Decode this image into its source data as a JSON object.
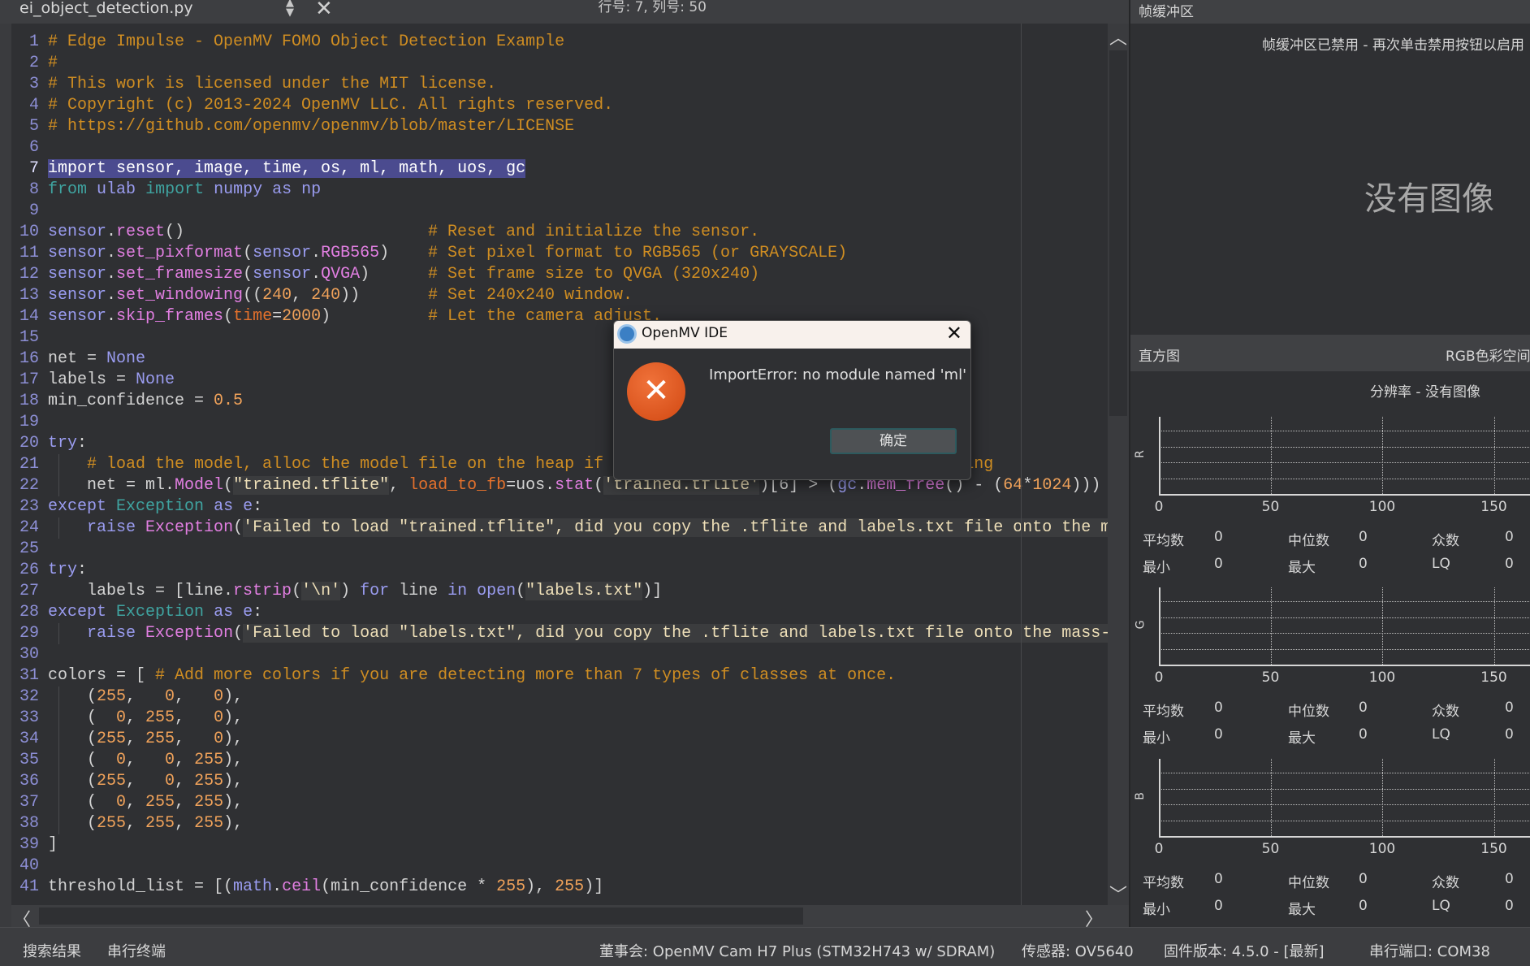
{
  "editor": {
    "filename": "ei_object_detection.py",
    "cursor_position": "行号: 7, 列号: 50",
    "current_line": 7,
    "lines": [
      {
        "n": 1,
        "tokens": [
          [
            "# Edge Impulse - OpenMV FOMO Object Detection Example",
            "c"
          ]
        ]
      },
      {
        "n": 2,
        "tokens": [
          [
            "#",
            "c"
          ]
        ]
      },
      {
        "n": 3,
        "tokens": [
          [
            "# This work is licensed under the MIT license.",
            "c"
          ]
        ]
      },
      {
        "n": 4,
        "tokens": [
          [
            "# Copyright (c) 2013-2024 OpenMV LLC. All rights reserved.",
            "c"
          ]
        ]
      },
      {
        "n": 5,
        "tokens": [
          [
            "# https://github.com/openmv/openmv/blob/master/LICENSE",
            "c"
          ]
        ]
      },
      {
        "n": 6,
        "tokens": []
      },
      {
        "n": 7,
        "tokens": [
          [
            "import sensor, image, time, os, ml, math, uos, gc",
            "sel"
          ]
        ]
      },
      {
        "n": 8,
        "tokens": [
          [
            "from",
            "k"
          ],
          [
            " ",
            "t"
          ],
          [
            "ulab",
            "v"
          ],
          [
            " ",
            "t"
          ],
          [
            "import",
            "k"
          ],
          [
            " ",
            "t"
          ],
          [
            "numpy as np",
            "v"
          ]
        ]
      },
      {
        "n": 9,
        "tokens": []
      },
      {
        "n": 10,
        "tokens": [
          [
            "sensor",
            "v"
          ],
          [
            ".",
            "t"
          ],
          [
            "reset",
            "f"
          ],
          [
            "()",
            "t"
          ],
          [
            "# Reset and initialize the sensor.",
            "ac"
          ]
        ]
      },
      {
        "n": 11,
        "tokens": [
          [
            "sensor",
            "v"
          ],
          [
            ".",
            "t"
          ],
          [
            "set_pixformat",
            "f"
          ],
          [
            "(",
            "t"
          ],
          [
            "sensor",
            "v"
          ],
          [
            ".",
            "t"
          ],
          [
            "RGB565",
            "f"
          ],
          [
            ")",
            "t"
          ],
          [
            "# Set pixel format to RGB565 (or GRAYSCALE)",
            "ac"
          ]
        ]
      },
      {
        "n": 12,
        "tokens": [
          [
            "sensor",
            "v"
          ],
          [
            ".",
            "t"
          ],
          [
            "set_framesize",
            "f"
          ],
          [
            "(",
            "t"
          ],
          [
            "sensor",
            "v"
          ],
          [
            ".",
            "t"
          ],
          [
            "QVGA",
            "f"
          ],
          [
            ")",
            "t"
          ],
          [
            "# Set frame size to QVGA (320x240)",
            "ac"
          ]
        ]
      },
      {
        "n": 13,
        "tokens": [
          [
            "sensor",
            "v"
          ],
          [
            ".",
            "t"
          ],
          [
            "set_windowing",
            "f"
          ],
          [
            "((",
            "t"
          ],
          [
            "240",
            "n"
          ],
          [
            ", ",
            "t"
          ],
          [
            "240",
            "n"
          ],
          [
            "))",
            "t"
          ],
          [
            "# Set 240x240 window.",
            "ac"
          ]
        ]
      },
      {
        "n": 14,
        "tokens": [
          [
            "sensor",
            "v"
          ],
          [
            ".",
            "t"
          ],
          [
            "skip_frames",
            "f"
          ],
          [
            "(",
            "t"
          ],
          [
            "time",
            "o"
          ],
          [
            "=",
            "t"
          ],
          [
            "2000",
            "n"
          ],
          [
            ")",
            "t"
          ],
          [
            "# Let the camera adjust.",
            "ac"
          ]
        ]
      },
      {
        "n": 15,
        "tokens": []
      },
      {
        "n": 16,
        "tokens": [
          [
            "net = ",
            "t"
          ],
          [
            "None",
            "v"
          ]
        ]
      },
      {
        "n": 17,
        "tokens": [
          [
            "labels = ",
            "t"
          ],
          [
            "None",
            "v"
          ]
        ]
      },
      {
        "n": 18,
        "tokens": [
          [
            "min_confidence = ",
            "t"
          ],
          [
            "0.5",
            "n"
          ]
        ]
      },
      {
        "n": 19,
        "tokens": []
      },
      {
        "n": 20,
        "tokens": [
          [
            "try",
            "v"
          ],
          [
            ":",
            "t"
          ]
        ]
      },
      {
        "n": 21,
        "tokens": [
          [
            "    ",
            "t"
          ],
          [
            "# load the model, alloc the model file on the heap if we have at least 64K free after loading",
            "c"
          ]
        ]
      },
      {
        "n": 22,
        "tokens": [
          [
            "    net = ml.",
            "t"
          ],
          [
            "Model",
            "f"
          ],
          [
            "(",
            "t"
          ],
          [
            "\"trained.tflite\"",
            "s"
          ],
          [
            ", ",
            "t"
          ],
          [
            "load_to_fb",
            "o"
          ],
          [
            "=uos.",
            "t"
          ],
          [
            "stat",
            "f"
          ],
          [
            "(",
            "t"
          ],
          [
            "'trained.tflite'",
            "s"
          ],
          [
            ")[6] > (",
            "t"
          ],
          [
            "gc",
            "v"
          ],
          [
            ".",
            "t"
          ],
          [
            "mem_free",
            "f"
          ],
          [
            "() - (",
            "t"
          ],
          [
            "64",
            "n"
          ],
          [
            "*",
            "t"
          ],
          [
            "1024",
            "n"
          ],
          [
            ")))",
            "t"
          ]
        ]
      },
      {
        "n": 23,
        "tokens": [
          [
            "except",
            "v"
          ],
          [
            " ",
            "t"
          ],
          [
            "Exception",
            "k"
          ],
          [
            " ",
            "t"
          ],
          [
            "as e",
            "v"
          ],
          [
            ":",
            "t"
          ]
        ]
      },
      {
        "n": 24,
        "tokens": [
          [
            "    ",
            "t"
          ],
          [
            "raise",
            "v"
          ],
          [
            " ",
            "t"
          ],
          [
            "Exception",
            "f"
          ],
          [
            "(",
            "t"
          ],
          [
            "'Failed to load \"trained.tflite\", did you copy the .tflite and labels.txt file onto the m",
            "s"
          ]
        ]
      },
      {
        "n": 25,
        "tokens": []
      },
      {
        "n": 26,
        "tokens": [
          [
            "try",
            "v"
          ],
          [
            ":",
            "t"
          ]
        ]
      },
      {
        "n": 27,
        "tokens": [
          [
            "    labels = [line.",
            "t"
          ],
          [
            "rstrip",
            "f"
          ],
          [
            "(",
            "t"
          ],
          [
            "'\\n'",
            "s"
          ],
          [
            ") ",
            "t"
          ],
          [
            "for",
            "v"
          ],
          [
            " line ",
            "t"
          ],
          [
            "in open",
            "v"
          ],
          [
            "(",
            "t"
          ],
          [
            "\"labels.txt\"",
            "s"
          ],
          [
            ")]",
            "t"
          ]
        ]
      },
      {
        "n": 28,
        "tokens": [
          [
            "except",
            "v"
          ],
          [
            " ",
            "t"
          ],
          [
            "Exception",
            "k"
          ],
          [
            " ",
            "t"
          ],
          [
            "as e",
            "v"
          ],
          [
            ":",
            "t"
          ]
        ]
      },
      {
        "n": 29,
        "tokens": [
          [
            "    ",
            "t"
          ],
          [
            "raise",
            "v"
          ],
          [
            " ",
            "t"
          ],
          [
            "Exception",
            "f"
          ],
          [
            "(",
            "t"
          ],
          [
            "'Failed to load \"labels.txt\", did you copy the .tflite and labels.txt file onto the mass-",
            "s"
          ]
        ]
      },
      {
        "n": 30,
        "tokens": []
      },
      {
        "n": 31,
        "tokens": [
          [
            "colors = [ ",
            "t"
          ],
          [
            "# Add more colors if you are detecting more than 7 types of classes at once.",
            "c"
          ]
        ]
      },
      {
        "n": 32,
        "tokens": [
          [
            "    (",
            "t"
          ],
          [
            "255",
            "n"
          ],
          [
            ",   ",
            "t"
          ],
          [
            "0",
            "n"
          ],
          [
            ",   ",
            "t"
          ],
          [
            "0",
            "n"
          ],
          [
            "),",
            "t"
          ]
        ]
      },
      {
        "n": 33,
        "tokens": [
          [
            "    (  ",
            "t"
          ],
          [
            "0",
            "n"
          ],
          [
            ", ",
            "t"
          ],
          [
            "255",
            "n"
          ],
          [
            ",   ",
            "t"
          ],
          [
            "0",
            "n"
          ],
          [
            "),",
            "t"
          ]
        ]
      },
      {
        "n": 34,
        "tokens": [
          [
            "    (",
            "t"
          ],
          [
            "255",
            "n"
          ],
          [
            ", ",
            "t"
          ],
          [
            "255",
            "n"
          ],
          [
            ",   ",
            "t"
          ],
          [
            "0",
            "n"
          ],
          [
            "),",
            "t"
          ]
        ]
      },
      {
        "n": 35,
        "tokens": [
          [
            "    (  ",
            "t"
          ],
          [
            "0",
            "n"
          ],
          [
            ",   ",
            "t"
          ],
          [
            "0",
            "n"
          ],
          [
            ", ",
            "t"
          ],
          [
            "255",
            "n"
          ],
          [
            "),",
            "t"
          ]
        ]
      },
      {
        "n": 36,
        "tokens": [
          [
            "    (",
            "t"
          ],
          [
            "255",
            "n"
          ],
          [
            ",   ",
            "t"
          ],
          [
            "0",
            "n"
          ],
          [
            ", ",
            "t"
          ],
          [
            "255",
            "n"
          ],
          [
            "),",
            "t"
          ]
        ]
      },
      {
        "n": 37,
        "tokens": [
          [
            "    (  ",
            "t"
          ],
          [
            "0",
            "n"
          ],
          [
            ", ",
            "t"
          ],
          [
            "255",
            "n"
          ],
          [
            ", ",
            "t"
          ],
          [
            "255",
            "n"
          ],
          [
            "),",
            "t"
          ]
        ]
      },
      {
        "n": 38,
        "tokens": [
          [
            "    (",
            "t"
          ],
          [
            "255",
            "n"
          ],
          [
            ", ",
            "t"
          ],
          [
            "255",
            "n"
          ],
          [
            ", ",
            "t"
          ],
          [
            "255",
            "n"
          ],
          [
            "),",
            "t"
          ]
        ]
      },
      {
        "n": 39,
        "tokens": [
          [
            "]",
            "t"
          ]
        ]
      },
      {
        "n": 40,
        "tokens": []
      },
      {
        "n": 41,
        "tokens": [
          [
            "threshold_list = [(",
            "t"
          ],
          [
            "math",
            "v"
          ],
          [
            ".",
            "t"
          ],
          [
            "ceil",
            "f"
          ],
          [
            "(min_confidence * ",
            "t"
          ],
          [
            "255",
            "n"
          ],
          [
            "), ",
            "t"
          ],
          [
            "255",
            "n"
          ],
          [
            ")]",
            "t"
          ]
        ]
      }
    ]
  },
  "framebuffer": {
    "title": "帧缓冲区",
    "message": "帧缓冲区已禁用 - 再次单击禁用按钮以启用",
    "no_image": "没有图像"
  },
  "histogram": {
    "title": "直方图",
    "colorspace": "RGB色彩空间",
    "resolution": "分辨率 - 没有图像",
    "x_ticks": [
      "0",
      "50",
      "100",
      "150"
    ],
    "stat_labels": {
      "mean": "平均数",
      "median": "中位数",
      "mode": "众数",
      "min": "最小",
      "max": "最大",
      "lq": "LQ"
    },
    "channels": [
      {
        "name": "R",
        "mean": "0",
        "median": "0",
        "mode": "0",
        "min": "0",
        "max": "0",
        "lq": "0"
      },
      {
        "name": "G",
        "mean": "0",
        "median": "0",
        "mode": "0",
        "min": "0",
        "max": "0",
        "lq": "0"
      },
      {
        "name": "B",
        "mean": "0",
        "median": "0",
        "mode": "0",
        "min": "0",
        "max": "0",
        "lq": "0"
      }
    ]
  },
  "dialog": {
    "title": "OpenMV IDE",
    "message": "ImportError: no module named 'ml'",
    "ok_label": "确定"
  },
  "statusbar": {
    "search_results": "搜索结果",
    "serial_terminal": "串行终端",
    "board": "董事会: OpenMV Cam H7 Plus (STM32H743 w/ SDRAM)",
    "sensor": "传感器: OV5640",
    "firmware": "固件版本: 4.5.0 - [最新]",
    "serial_port": "串行端口: COM38"
  }
}
